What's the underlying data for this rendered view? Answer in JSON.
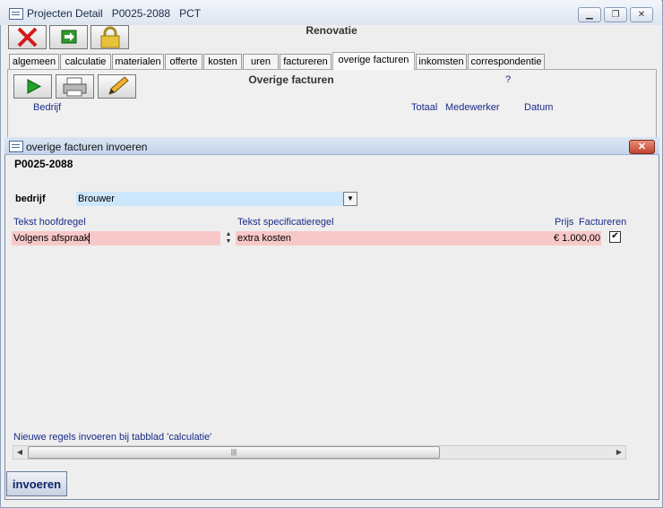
{
  "window": {
    "title": "Projecten Detail   P0025-2088   PCT"
  },
  "toolbar": {
    "project_name": "Renovatie"
  },
  "tabs": [
    {
      "label": "algemeen",
      "active": false
    },
    {
      "label": "calculatie",
      "active": false
    },
    {
      "label": "materialen",
      "active": false
    },
    {
      "label": "offerte",
      "active": false
    },
    {
      "label": "kosten",
      "active": false
    },
    {
      "label": "uren",
      "active": false
    },
    {
      "label": "factureren",
      "active": false
    },
    {
      "label": "overige facturen",
      "active": true
    },
    {
      "label": "inkomsten",
      "active": false
    },
    {
      "label": "correspondentie",
      "active": false
    }
  ],
  "panel": {
    "heading": "Overige facturen",
    "help": "?",
    "columns": {
      "bedrijf": "Bedrijf",
      "totaal": "Totaal",
      "medewerker": "Medewerker",
      "datum": "Datum"
    }
  },
  "dialog": {
    "title": "overige facturen invoeren",
    "close": "✕",
    "project_number": "P0025-2088",
    "bedrijf_label": "bedrijf",
    "bedrijf_value": "Brouwer",
    "headers": {
      "hoofdregel": "Tekst hoofdregel",
      "specificatie": "Tekst specificatieregel",
      "prijs": "Prijs",
      "factureren": "Factureren"
    },
    "row": {
      "hoofdregel": "Volgens afspraak",
      "specificatie": "extra kosten",
      "prijs": "€ 1.000,00",
      "factureren": true
    },
    "hint": "Nieuwe regels invoeren bij tabblad 'calculatie'",
    "submit_label": "invoeren"
  },
  "colors": {
    "field_blue": "#cce6fb",
    "field_pink": "#f8c8c8",
    "label_blue": "#1a2b8a"
  },
  "icons": [
    "window-icon",
    "delete-icon",
    "exit-icon",
    "lock-icon",
    "play-icon",
    "printer-icon",
    "edit-icon",
    "checkbox-icon"
  ]
}
